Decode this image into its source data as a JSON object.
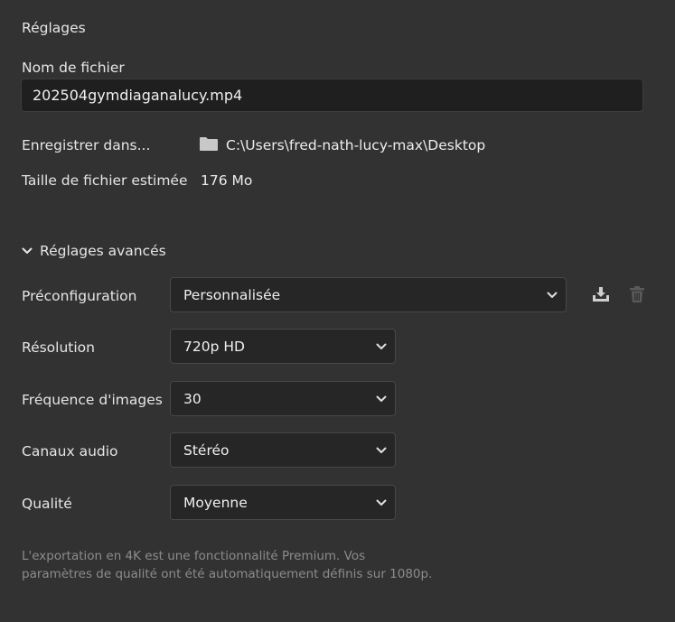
{
  "panel": {
    "title": "Réglages"
  },
  "filename": {
    "label": "Nom de fichier",
    "value": "202504gymdiaganalucy.mp4"
  },
  "save_location": {
    "label": "Enregistrer dans...",
    "icon": "folder-icon",
    "path": "C:\\Users\\fred-nath-lucy-max\\Desktop"
  },
  "file_size": {
    "label": "Taille de fichier estimée",
    "value": "176 Mo"
  },
  "advanced": {
    "label": "Réglages avancés",
    "expanded": true
  },
  "preset": {
    "label": "Préconfiguration",
    "value": "Personnalisée",
    "save_icon": "download-icon",
    "delete_icon": "trash-icon"
  },
  "resolution": {
    "label": "Résolution",
    "value": "720p HD"
  },
  "framerate": {
    "label": "Fréquence d'images",
    "value": "30"
  },
  "audio": {
    "label": "Canaux audio",
    "value": "Stéréo"
  },
  "quality": {
    "label": "Qualité",
    "value": "Moyenne"
  },
  "footer_note": {
    "line1": "L'exportation en 4K est une fonctionnalité Premium. Vos",
    "line2": "paramètres de qualité ont été automatiquement définis sur 1080p."
  },
  "colors": {
    "background": "#323232",
    "field_background": "#1f1f1f",
    "select_background": "#262626",
    "text": "#e8e8e8",
    "muted_text": "#8c8c8c"
  }
}
